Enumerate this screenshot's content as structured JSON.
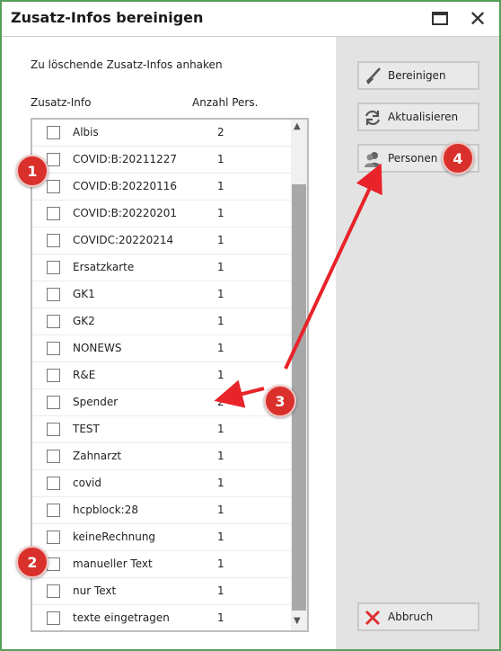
{
  "window": {
    "title": "Zusatz-Infos bereinigen"
  },
  "instruction": "Zu löschende Zusatz-Infos anhaken",
  "columns": {
    "info": "Zusatz-Info",
    "count": "Anzahl Pers."
  },
  "items": [
    {
      "label": "Albis",
      "count": "2"
    },
    {
      "label": "COVID:B:20211227",
      "count": "1"
    },
    {
      "label": "COVID:B:20220116",
      "count": "1"
    },
    {
      "label": "COVID:B:20220201",
      "count": "1"
    },
    {
      "label": "COVIDC:20220214",
      "count": "1"
    },
    {
      "label": "Ersatzkarte",
      "count": "1"
    },
    {
      "label": "GK1",
      "count": "1"
    },
    {
      "label": "GK2",
      "count": "1"
    },
    {
      "label": "NONEWS",
      "count": "1"
    },
    {
      "label": "R&E",
      "count": "1"
    },
    {
      "label": "Spender",
      "count": "2"
    },
    {
      "label": "TEST",
      "count": "1"
    },
    {
      "label": "Zahnarzt",
      "count": "1"
    },
    {
      "label": "covid",
      "count": "1"
    },
    {
      "label": "hcpblock:28",
      "count": "1"
    },
    {
      "label": "keineRechnung",
      "count": "1"
    },
    {
      "label": "manueller Text",
      "count": "1"
    },
    {
      "label": "nur Text",
      "count": "1"
    },
    {
      "label": "texte eingetragen",
      "count": "1"
    }
  ],
  "buttons": {
    "bereinigen": "Bereinigen",
    "aktualisieren": "Aktualisieren",
    "personen": "Personen",
    "abbruch": "Abbruch"
  },
  "annotations": {
    "badge1": "1",
    "badge2": "2",
    "badge3": "3",
    "badge4": "4"
  },
  "colors": {
    "window_border": "#57a05a",
    "annotation_red": "#d9302b",
    "panel_gray": "#e3e3e3"
  }
}
